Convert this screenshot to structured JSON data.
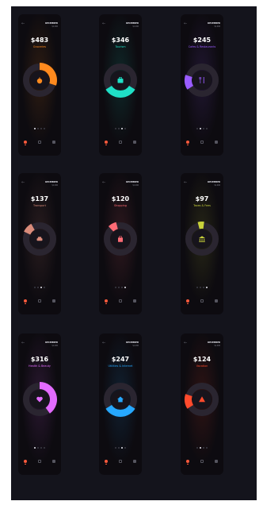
{
  "month_label": "DECEMBER",
  "cards": [
    {
      "amount": "$483",
      "category": "Groceries",
      "color": "#ff8a1e",
      "arc_fraction": 0.3,
      "arc_start": 0.0,
      "icon": "apple-icon",
      "active_dot": 0,
      "month_sub": "$1,490"
    },
    {
      "amount": "$346",
      "category": "Tourism",
      "color": "#1fe0c6",
      "arc_fraction": 0.32,
      "arc_start": 0.34,
      "icon": "suitcase-icon",
      "active_dot": 2,
      "month_sub": "$1,490"
    },
    {
      "amount": "$245",
      "category": "Cafes & Restaurants",
      "color": "#9a5cff",
      "arc_fraction": 0.14,
      "arc_start": 0.66,
      "icon": "cutlery-icon",
      "active_dot": 1,
      "month_sub": "$1,490"
    },
    {
      "amount": "$137",
      "category": "Transport",
      "color": "#d98b7a",
      "arc_fraction": 0.1,
      "arc_start": 0.82,
      "icon": "car-icon",
      "active_dot": 2,
      "month_sub": "$1,490"
    },
    {
      "amount": "$120",
      "category": "Shopping",
      "color": "#ff6b75",
      "arc_fraction": 0.08,
      "arc_start": 0.88,
      "icon": "bag-icon",
      "active_dot": 3,
      "month_sub": "$1,490"
    },
    {
      "amount": "$97",
      "category": "Taxes & Fees",
      "color": "#c8d13a",
      "arc_fraction": 0.06,
      "arc_start": 0.96,
      "icon": "bank-icon",
      "active_dot": 3,
      "month_sub": "$1,490"
    },
    {
      "amount": "$316",
      "category": "Health & Beauty",
      "color": "#e36bff",
      "arc_fraction": 0.4,
      "arc_start": 0.0,
      "icon": "heart-icon",
      "active_dot": 0,
      "month_sub": "$1,490"
    },
    {
      "amount": "$247",
      "category": "Utilities & Internet",
      "color": "#26a8ff",
      "arc_fraction": 0.32,
      "arc_start": 0.34,
      "icon": "house-icon",
      "active_dot": 2,
      "month_sub": "$1,490"
    },
    {
      "amount": "$124",
      "category": "Vacation",
      "color": "#ff4a2c",
      "arc_fraction": 0.14,
      "arc_start": 0.66,
      "icon": "warning-icon",
      "active_dot": 1,
      "month_sub": "$1,490"
    }
  ]
}
